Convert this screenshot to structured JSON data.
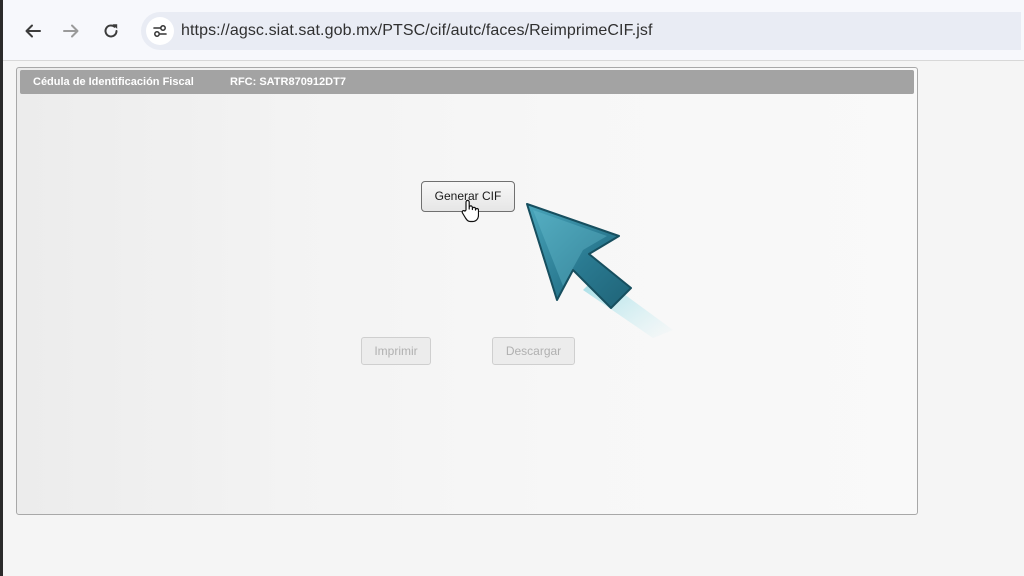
{
  "browser": {
    "url": "https://agsc.siat.sat.gob.mx/PTSC/cif/autc/faces/ReimprimeCIF.jsf",
    "icons": {
      "back": "arrow-left-icon",
      "forward": "arrow-right-icon",
      "reload": "reload-icon",
      "site_info": "tune-icon"
    }
  },
  "panel": {
    "title": "Cédula de Identificación Fiscal",
    "rfc": "RFC: SATR870912DT7"
  },
  "buttons": {
    "generar": "Generar CIF",
    "imprimir": "Imprimir",
    "descargar": "Descargar"
  },
  "colors": {
    "header": "#a3a3a3",
    "pointer": "#2f7f96"
  }
}
